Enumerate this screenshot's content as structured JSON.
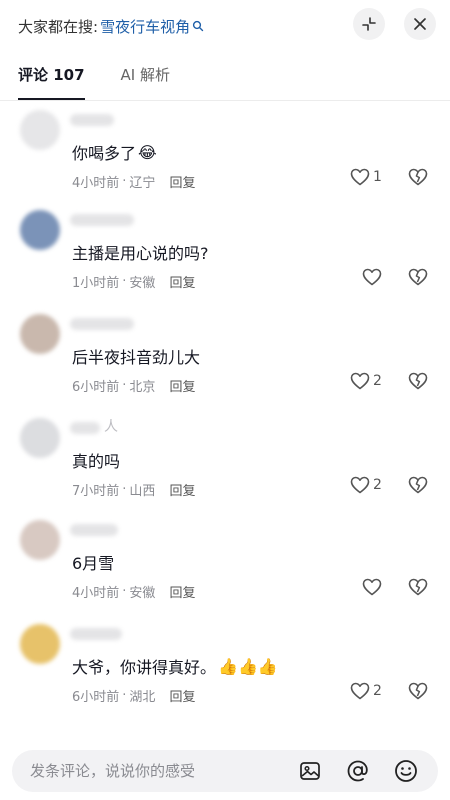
{
  "header": {
    "search_prefix": "大家都在搜:",
    "search_term": "雪夜行车视角"
  },
  "tabs": [
    {
      "label": "评论 107"
    },
    {
      "label": "AI 解析"
    }
  ],
  "comments": [
    {
      "text": "你喝多了",
      "emoji": "😂",
      "time": "4小时前",
      "region": "辽宁",
      "reply": "回复",
      "likes": "1"
    },
    {
      "text": "主播是用心说的吗?",
      "time": "1小时前",
      "region": "安徽",
      "reply": "回复",
      "likes": ""
    },
    {
      "text": "后半夜抖音劲儿大",
      "time": "6小时前",
      "region": "北京",
      "reply": "回复",
      "likes": "2"
    },
    {
      "text": "真的吗",
      "name_extra": "人",
      "time": "7小时前",
      "region": "山西",
      "reply": "回复",
      "likes": "2"
    },
    {
      "text": "6月雪",
      "time": "4小时前",
      "region": "安徽",
      "reply": "回复",
      "likes": ""
    },
    {
      "text": "大爷，你讲得真好。",
      "emoji": "👍👍👍",
      "time": "6小时前",
      "region": "湖北",
      "reply": "回复",
      "likes": "2"
    }
  ],
  "input": {
    "placeholder": "发条评论，说说你的感受"
  },
  "colors": {
    "search_term": "#1f5fa8",
    "meta": "#8a8b91"
  }
}
